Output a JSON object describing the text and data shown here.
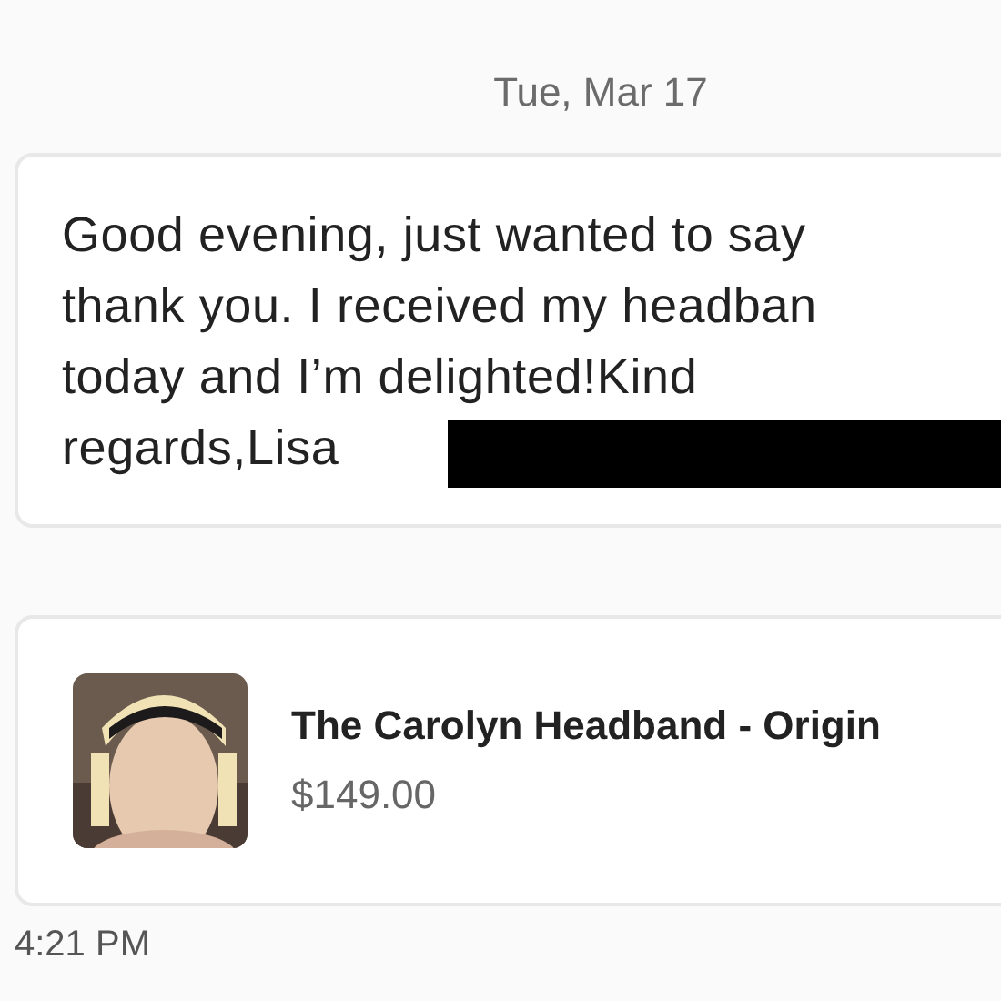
{
  "date_divider": "Tue, Mar 17",
  "message": {
    "lines": [
      "Good evening, just wanted to say",
      "thank you. I received my headban",
      "today and I’m delighted!Kind",
      "regards,Lisa"
    ],
    "redacted": true
  },
  "product_card": {
    "title": "The Carolyn Headband - Origin",
    "price": "$149.00"
  },
  "time": "4:21 PM"
}
